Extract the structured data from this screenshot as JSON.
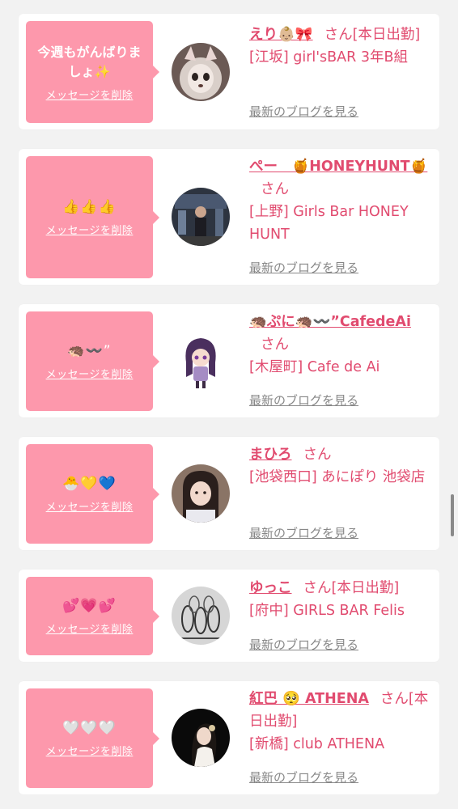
{
  "delete_label": "メッセージを削除",
  "blog_label": "最新のブログを見る",
  "honorific": "さん",
  "entries": [
    {
      "message": "今週もがんばりましょ✨",
      "name": "えり👶🏼🎀",
      "status": "[本日出勤]",
      "shop": "[江坂] girl'sBAR 3年B組"
    },
    {
      "message": "👍👍👍",
      "name": "ぺー　🍯HONEYHUNT🍯",
      "status": "",
      "shop": "[上野] Girls Bar HONEY HUNT"
    },
    {
      "message": "🦔〰️”",
      "name": "🦔ぷに🦔〰️”CafedeAi",
      "status": "",
      "shop": "[木屋町] Cafe de Ai"
    },
    {
      "message": "🐣💛💙",
      "name": "まひろ",
      "status": "",
      "shop": "[池袋西口] あにぽり 池袋店"
    },
    {
      "message": "💕💗💕",
      "name": "ゆっこ",
      "status": "[本日出勤]",
      "shop": "[府中] GIRLS BAR Felis"
    },
    {
      "message": "🤍🤍🤍",
      "name": "紅巴 🥺 ATHENA",
      "status": "[本日出勤]",
      "shop": "[新橋] club ATHENA"
    }
  ],
  "colors": {
    "bubble": "#fd98ac",
    "name": "#e14b6f",
    "link_gray": "#888888",
    "background": "#f2f2f2"
  }
}
